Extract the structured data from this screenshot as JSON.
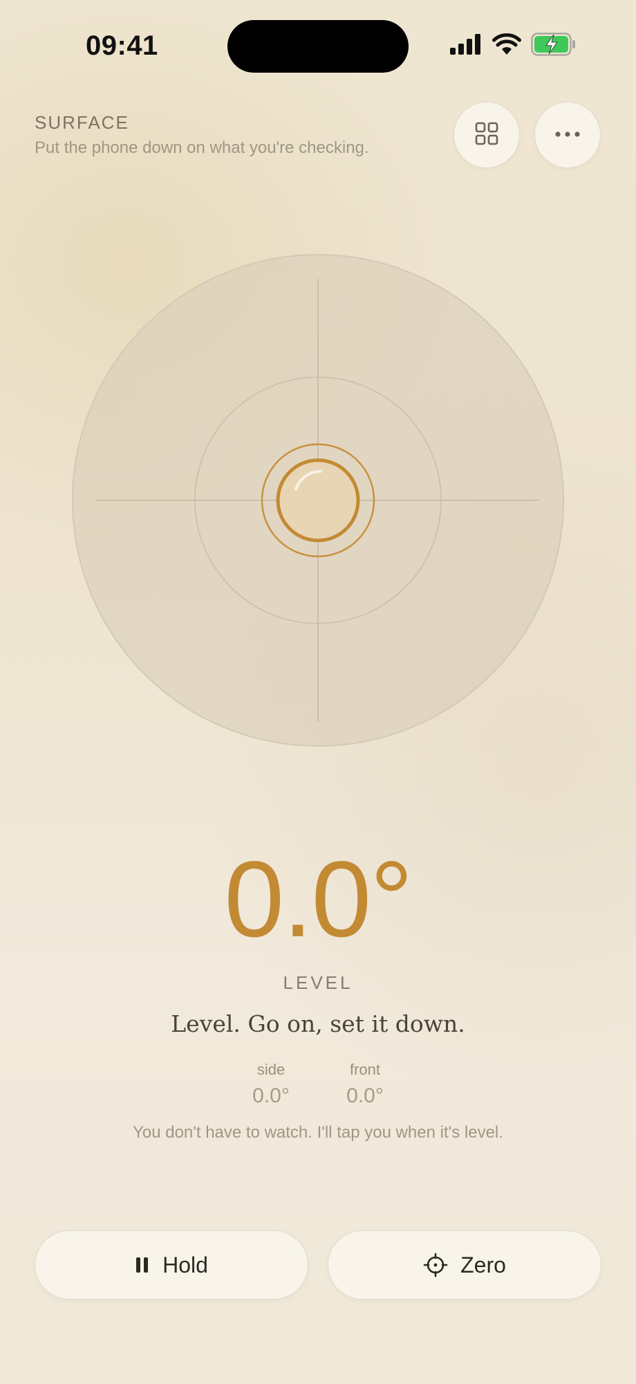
{
  "status_bar": {
    "time": "09:41",
    "icons": [
      "cellular-signal-icon",
      "wifi-icon",
      "battery-charging-icon"
    ],
    "battery_color": "#3fc85a"
  },
  "header": {
    "eyebrow": "SURFACE",
    "hint": "Put the phone down on what you're checking.",
    "buttons": [
      {
        "icon": "grid-icon"
      },
      {
        "icon": "more-icon"
      }
    ]
  },
  "gauge": {
    "bubble_offset_side_deg": 0.0,
    "bubble_offset_front_deg": 0.0,
    "accent_color": "#c38a34"
  },
  "readout": {
    "angle": "0.0°",
    "state": "LEVEL",
    "message": "Level. Go on, set it down.",
    "axes": [
      {
        "label": "side",
        "value": "0.0°"
      },
      {
        "label": "front",
        "value": "0.0°"
      }
    ],
    "reassurance": "You don't have to watch. I'll tap you when it's level."
  },
  "actions": {
    "hold_label": "Hold",
    "hold_icon": "pause-icon",
    "zero_label": "Zero",
    "zero_icon": "crosshair-icon"
  }
}
